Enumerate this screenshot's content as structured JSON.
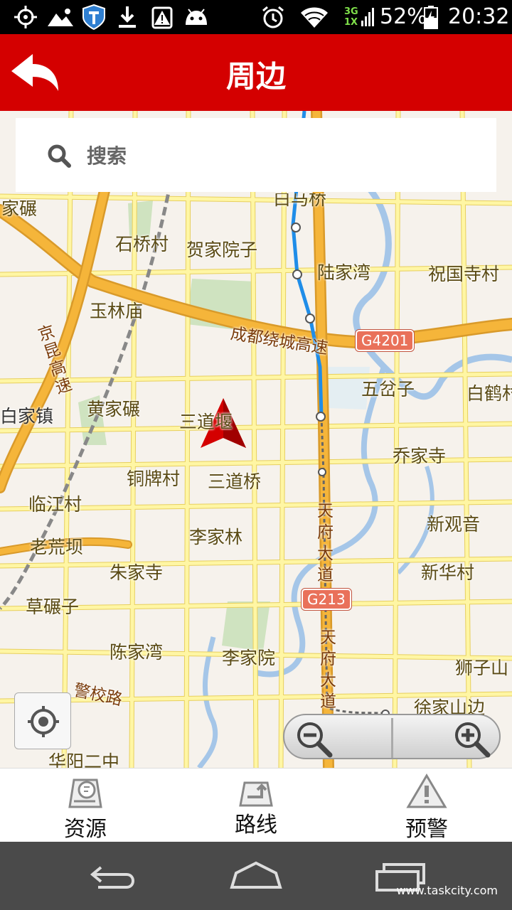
{
  "status_bar": {
    "battery": "52%",
    "time": "20:32",
    "network_top": "3G",
    "network_bottom": "1X",
    "icons": [
      "gps-icon",
      "picture-icon",
      "shield-app-icon",
      "download-icon",
      "warning-battery-icon",
      "android-icon",
      "alarm-icon",
      "wifi-icon",
      "signal-icon",
      "battery-icon"
    ]
  },
  "header": {
    "title": "周边",
    "back_icon": "back-arrow-icon"
  },
  "search": {
    "placeholder": "搜索",
    "icon": "search-icon"
  },
  "map": {
    "places": [
      {
        "name": "家碾"
      },
      {
        "name": "石桥村"
      },
      {
        "name": "贺家院子"
      },
      {
        "name": "白马桥"
      },
      {
        "name": "陆家湾"
      },
      {
        "name": "祝国寺村"
      },
      {
        "name": "玉林庙"
      },
      {
        "name": "五岔子"
      },
      {
        "name": "白鹤村"
      },
      {
        "name": "白家镇"
      },
      {
        "name": "黄家碾"
      },
      {
        "name": "三道堰"
      },
      {
        "name": "乔家寺"
      },
      {
        "name": "铜牌村"
      },
      {
        "name": "三道桥"
      },
      {
        "name": "临江村"
      },
      {
        "name": "新观音"
      },
      {
        "name": "李家林"
      },
      {
        "name": "老荒坝"
      },
      {
        "name": "朱家寺"
      },
      {
        "name": "新华村"
      },
      {
        "name": "草碾子"
      },
      {
        "name": "陈家湾"
      },
      {
        "name": "李家院"
      },
      {
        "name": "狮子山"
      },
      {
        "name": "徐家山边"
      },
      {
        "name": "华阳二中"
      }
    ],
    "roads": {
      "ring": "成都绕城高速",
      "jingkun": "京昆高速",
      "tianfu_1": "天府大道",
      "tianfu_2": "天府大道",
      "jingxiao": "警校路"
    },
    "shields": {
      "g4201": "G4201",
      "g213": "G213"
    },
    "colors": {
      "background": "#f6f2ec",
      "road": "#fff6a4",
      "road_edge": "#e7cf5e",
      "highway": "#f5b53a",
      "river": "#a5c6e8",
      "metro": "#1f8de8",
      "green": "#cfe3c0",
      "heading_arrow": "#d40000"
    }
  },
  "controls": {
    "locate_icon": "locate-icon",
    "zoom_out_icon": "zoom-out-icon",
    "zoom_in_icon": "zoom-in-icon"
  },
  "tabs": [
    {
      "label": "资源",
      "icon": "map-resource-icon"
    },
    {
      "label": "路线",
      "icon": "route-icon"
    },
    {
      "label": "预警",
      "icon": "warning-icon"
    }
  ],
  "nav_bar": {
    "back_icon": "nav-back-icon",
    "home_icon": "nav-home-icon",
    "recent_icon": "nav-recent-icon",
    "watermark": "www.taskcity.com"
  }
}
